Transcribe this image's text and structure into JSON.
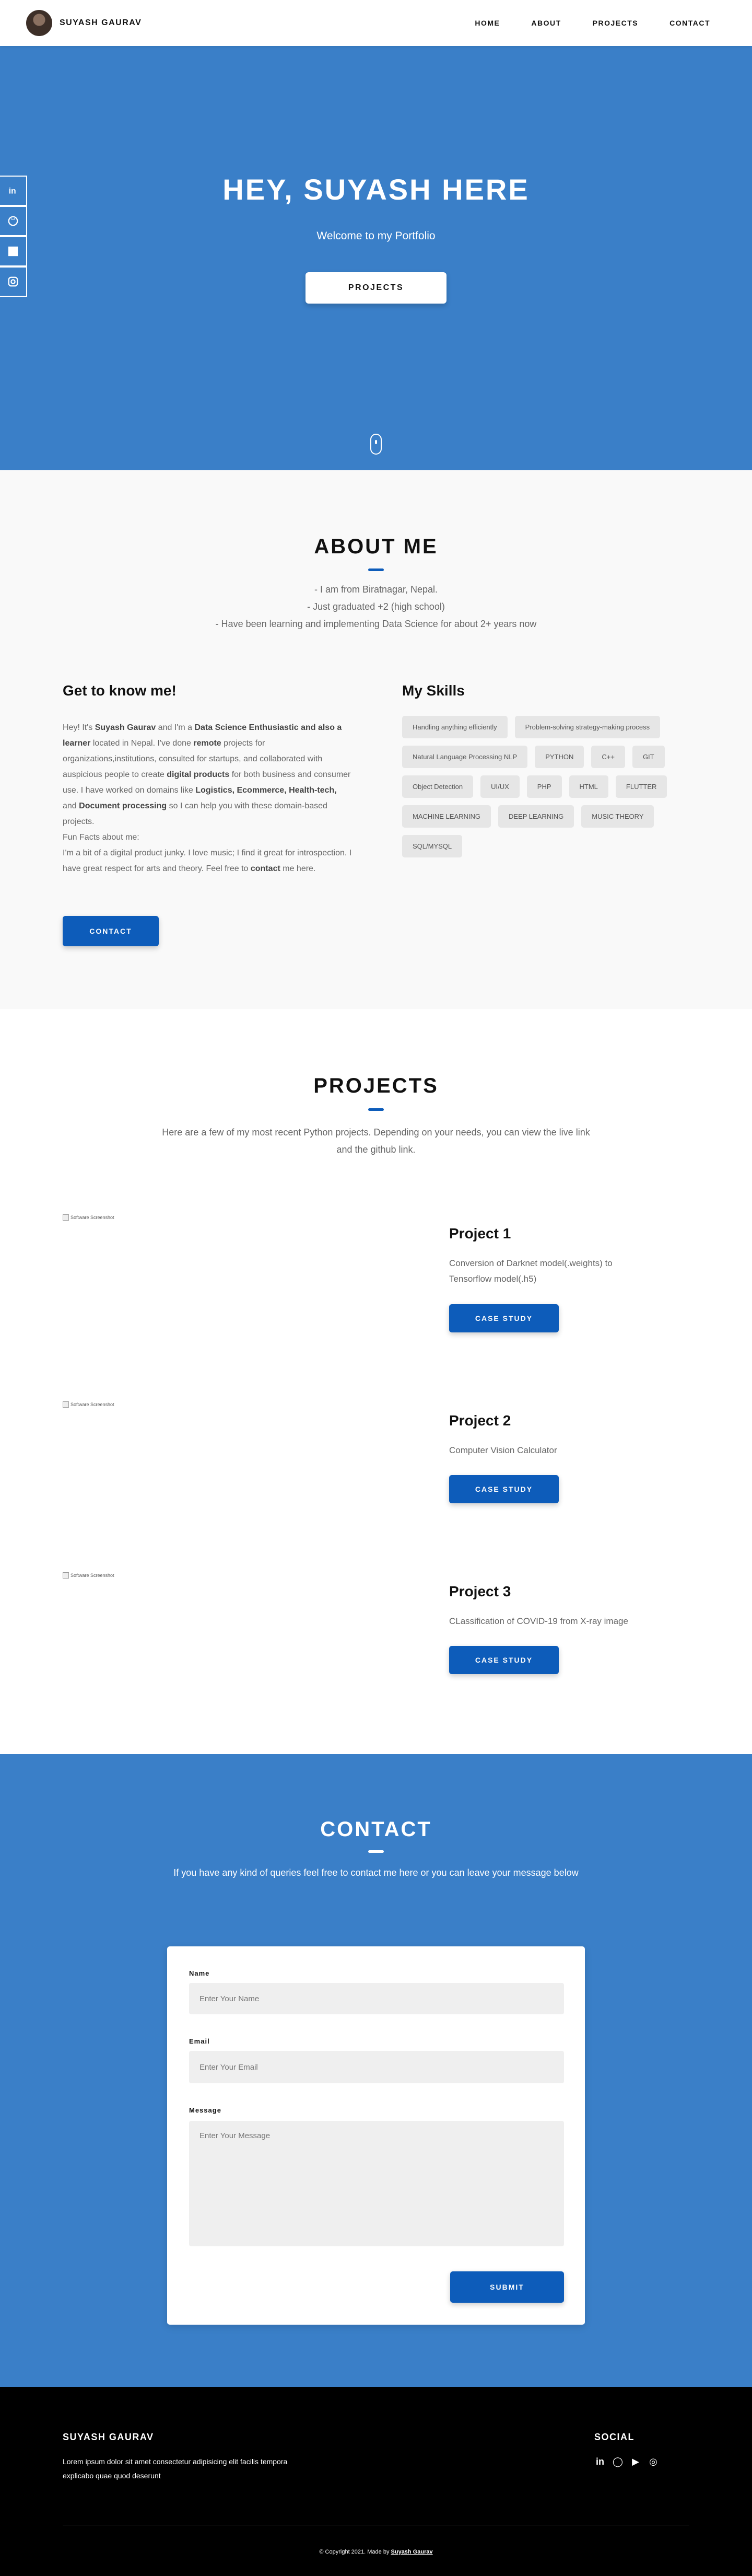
{
  "header": {
    "brand": "SUYASH GAURAV",
    "nav": [
      "HOME",
      "ABOUT",
      "PROJECTS",
      "CONTACT"
    ]
  },
  "hero": {
    "title": "HEY, SUYASH HERE",
    "subtitle": "Welcome to my Portfolio",
    "button": "PROJECTS",
    "social_icons": [
      "linkedin-icon",
      "github-icon",
      "blank-icon",
      "instagram-icon"
    ]
  },
  "about": {
    "title": "ABOUT ME",
    "intro": [
      "- I am from Biratnagar, Nepal.",
      "- Just graduated +2 (high school)",
      "- Have been learning and implementing Data Science for about 2+ years now"
    ],
    "know_title": "Get to know me!",
    "know_parts": {
      "p1": "Hey! It's ",
      "name": "Suyash Gaurav",
      "p2": " and I'm a ",
      "role": "Data Science Enthusiastic and also a learner",
      "p3": " located in Nepal. I've done ",
      "remote": "remote",
      "p4": " projects for organizations,institutions, consulted for startups, and collaborated with auspicious people to create ",
      "digital": "digital products",
      "p5": " for both business and consumer use. I have worked on domains like ",
      "domains": "Logistics, Ecommerce, Health-tech,",
      "p6": " and ",
      "docs": "Document processing",
      "p7": " so I can help you with these domain-based projects.",
      "fun_title": "Fun Facts about me:",
      "fun": "I'm a bit of a digital product junky. I love music; I find it great for introspection. I have great respect for arts and theory. Feel free to ",
      "contact": "contact",
      "fun_end": " me here."
    },
    "contact_button": "CONTACT",
    "skills_title": "My Skills",
    "skills": [
      "Handling anything efficiently",
      "Problem-solving strategy-making process",
      "Natural Language Processing NLP",
      "PYTHON",
      "C++",
      "GIT",
      "Object Detection",
      "UI/UX",
      "PHP",
      "HTML",
      "FLUTTER",
      "MACHINE LEARNING",
      "DEEP LEARNING",
      "MUSIC THEORY",
      "SQL/MYSQL"
    ]
  },
  "projects": {
    "title": "PROJECTS",
    "intro": "Here are a few of my most recent Python projects. Depending on your needs, you can view the live link and the github link.",
    "items": [
      {
        "img_alt": "Software Screenshot",
        "title": "Project 1",
        "desc": "Conversion of Darknet model(.weights) to Tensorflow model(.h5)",
        "button": "CASE STUDY"
      },
      {
        "img_alt": "Software Screenshot",
        "title": "Project 2",
        "desc": "Computer Vision Calculator",
        "button": "CASE STUDY"
      },
      {
        "img_alt": "Software Screenshot",
        "title": "Project 3",
        "desc": "CLassification of COVID-19 from X-ray image",
        "button": "CASE STUDY"
      }
    ]
  },
  "contact": {
    "title": "CONTACT",
    "intro": "If you have any kind of queries feel free to contact me here or you can leave your message below",
    "name_label": "Name",
    "name_placeholder": "Enter Your Name",
    "email_label": "Email",
    "email_placeholder": "Enter Your Email",
    "message_label": "Message",
    "message_placeholder": "Enter Your Message",
    "submit": "SUBMIT"
  },
  "footer": {
    "name": "SUYASH GAURAV",
    "desc": "Lorem ipsum dolor sit amet consectetur adipisicing elit facilis tempora explicabo quae quod deserunt",
    "social_title": "SOCIAL",
    "icons": {
      "linkedin": "in",
      "github": "◯",
      "youtube": "▶",
      "instagram": "◎"
    },
    "copyright": "© Copyright 2021. Made by ",
    "author": "Suyash Gaurav"
  },
  "colors": {
    "primary": "#3a7fc8",
    "button": "#0d5cba",
    "footer": "#000000"
  }
}
